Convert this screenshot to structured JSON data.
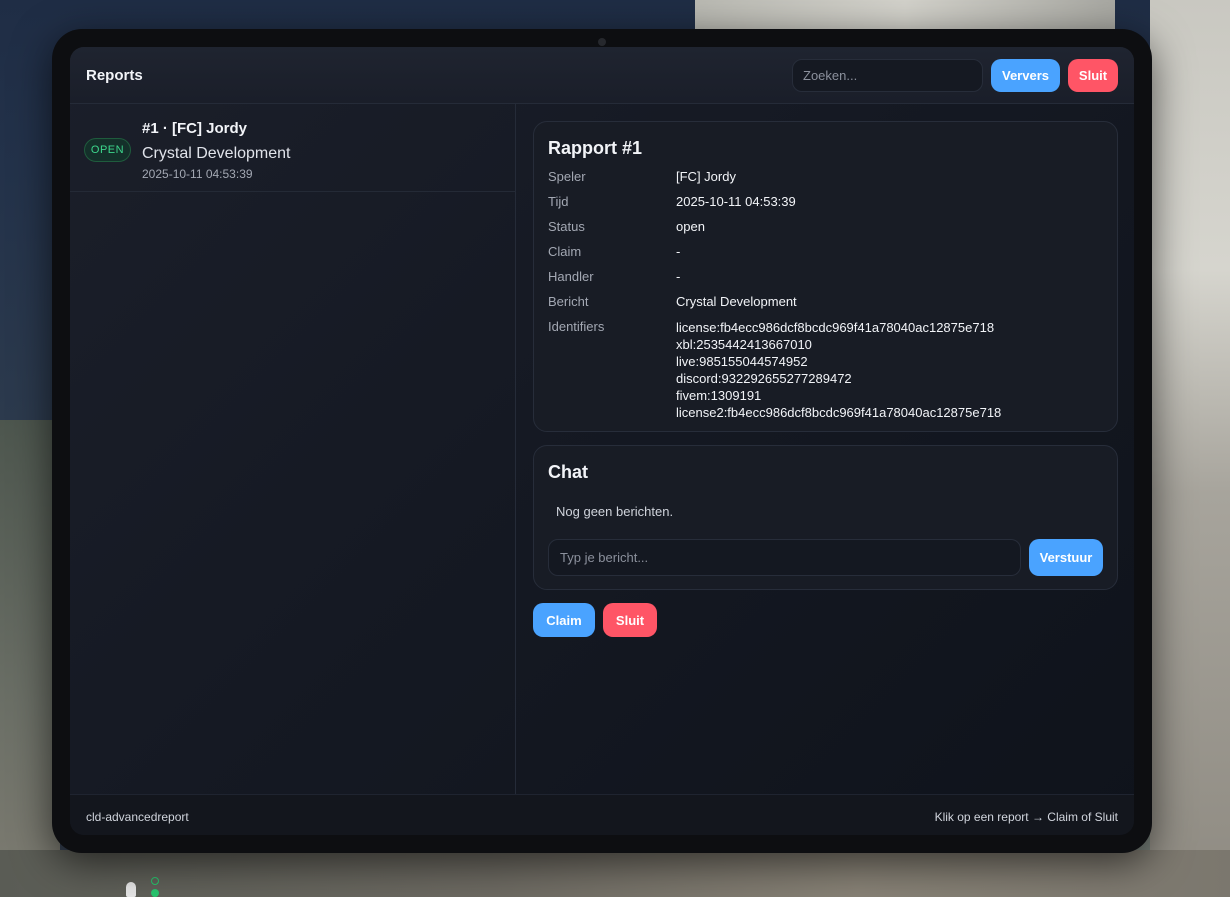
{
  "header": {
    "title": "Reports",
    "search_placeholder": "Zoeken...",
    "refresh_label": "Ververs",
    "close_label": "Sluit"
  },
  "reports": [
    {
      "status_badge": "OPEN",
      "title": "#1 · [FC] Jordy",
      "message": "Crystal Development",
      "time": "2025-10-11 04:53:39"
    }
  ],
  "detail": {
    "title": "Rapport #1",
    "rows": [
      {
        "label": "Speler",
        "value": "[FC] Jordy"
      },
      {
        "label": "Tijd",
        "value": "2025-10-11 04:53:39"
      },
      {
        "label": "Status",
        "value": "open"
      },
      {
        "label": "Claim",
        "value": "-"
      },
      {
        "label": "Handler",
        "value": "-"
      },
      {
        "label": "Bericht",
        "value": "Crystal Development"
      }
    ],
    "identifiers_label": "Identifiers",
    "identifiers": [
      "license:fb4ecc986dcf8bcdc969f41a78040ac12875e718",
      "xbl:2535442413667010",
      "live:985155044574952",
      "discord:932292655277289472",
      "fivem:1309191",
      "license2:fb4ecc986dcf8bcdc969f41a78040ac12875e718"
    ]
  },
  "chat": {
    "title": "Chat",
    "empty_text": "Nog geen berichten.",
    "input_placeholder": "Typ je bericht...",
    "send_label": "Verstuur"
  },
  "actions": {
    "claim_label": "Claim",
    "close_label": "Sluit"
  },
  "footer": {
    "left": "cld-advancedreport",
    "right": "Klik op een report → Claim of Sluit"
  },
  "colors": {
    "accent_blue": "#4aa3ff",
    "danger_red": "#ff5566",
    "open_green": "#3dd68c"
  }
}
